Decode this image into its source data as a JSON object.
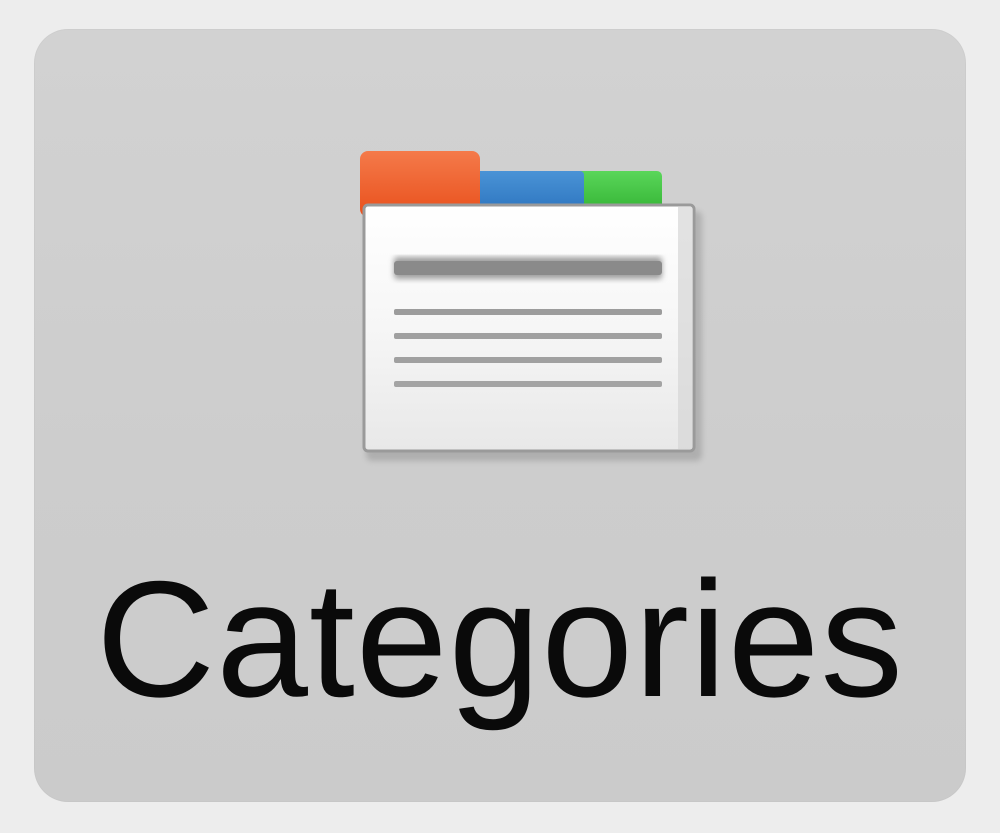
{
  "tile": {
    "label": "Categories",
    "icon": "categories-icon"
  },
  "colors": {
    "tab_orange": "#f05a22",
    "tab_blue": "#2f7fc8",
    "tab_green": "#3fbf3f",
    "tile_background": "#cfcfcf",
    "page_background": "#ededed",
    "label_text": "#0a0a0a"
  }
}
